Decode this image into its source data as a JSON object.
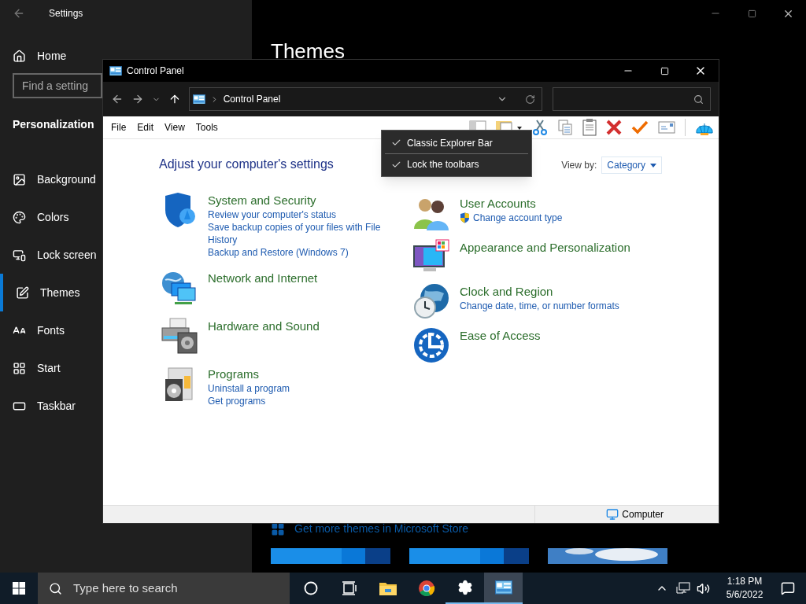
{
  "settings": {
    "title": "Settings",
    "home": "Home",
    "search_placeholder": "Find a setting",
    "section": "Personalization",
    "items": [
      {
        "kind": "background",
        "label": "Background",
        "selected": false
      },
      {
        "kind": "colors",
        "label": "Colors",
        "selected": false
      },
      {
        "kind": "lock",
        "label": "Lock screen",
        "selected": false
      },
      {
        "kind": "themes",
        "label": "Themes",
        "selected": true
      },
      {
        "kind": "fonts",
        "label": "Fonts",
        "selected": false
      },
      {
        "kind": "start",
        "label": "Start",
        "selected": false
      },
      {
        "kind": "taskbar",
        "label": "Taskbar",
        "selected": false
      }
    ],
    "page_title": "Themes",
    "store_link": "Get more themes in Microsoft Store"
  },
  "control_panel": {
    "title": "Control Panel",
    "address": "Control Panel",
    "menu": [
      "File",
      "Edit",
      "View",
      "Tools"
    ],
    "context_menu": [
      {
        "label": "Classic Explorer Bar",
        "checked": true
      },
      {
        "label": "Lock the toolbars",
        "checked": true
      }
    ],
    "heading": "Adjust your computer's settings",
    "view_by_label": "View by:",
    "view_by_value": "Category",
    "left_categories": [
      {
        "kind": "security",
        "title": "System and Security",
        "links": [
          {
            "text": "Review your computer's status",
            "shield": false
          },
          {
            "text": "Save backup copies of your files with File History",
            "shield": false
          },
          {
            "text": "Backup and Restore (Windows 7)",
            "shield": false
          }
        ]
      },
      {
        "kind": "network",
        "title": "Network and Internet"
      },
      {
        "kind": "hardware",
        "title": "Hardware and Sound"
      },
      {
        "kind": "programs",
        "title": "Programs",
        "links": [
          {
            "text": "Uninstall a program",
            "shield": false
          },
          {
            "text": "Get programs",
            "shield": false
          }
        ]
      }
    ],
    "right_categories": [
      {
        "kind": "users",
        "title": "User Accounts",
        "links": [
          {
            "text": "Change account type",
            "shield": true
          }
        ]
      },
      {
        "kind": "appearance",
        "title": "Appearance and Personalization"
      },
      {
        "kind": "clock",
        "title": "Clock and Region",
        "links": [
          {
            "text": "Change date, time, or number formats",
            "shield": false
          }
        ]
      },
      {
        "kind": "access",
        "title": "Ease of Access"
      }
    ],
    "status": "Computer"
  },
  "taskbar": {
    "search_placeholder": "Type here to search",
    "time": "1:18 PM",
    "date": "5/6/2022",
    "apps": [
      {
        "kind": "cortana",
        "running": false,
        "selected": false
      },
      {
        "kind": "taskview",
        "running": false,
        "selected": false
      },
      {
        "kind": "explorer",
        "running": false,
        "selected": false
      },
      {
        "kind": "chrome",
        "running": false,
        "selected": false
      },
      {
        "kind": "settings",
        "running": true,
        "selected": false
      },
      {
        "kind": "control-panel",
        "running": true,
        "selected": true
      }
    ]
  }
}
